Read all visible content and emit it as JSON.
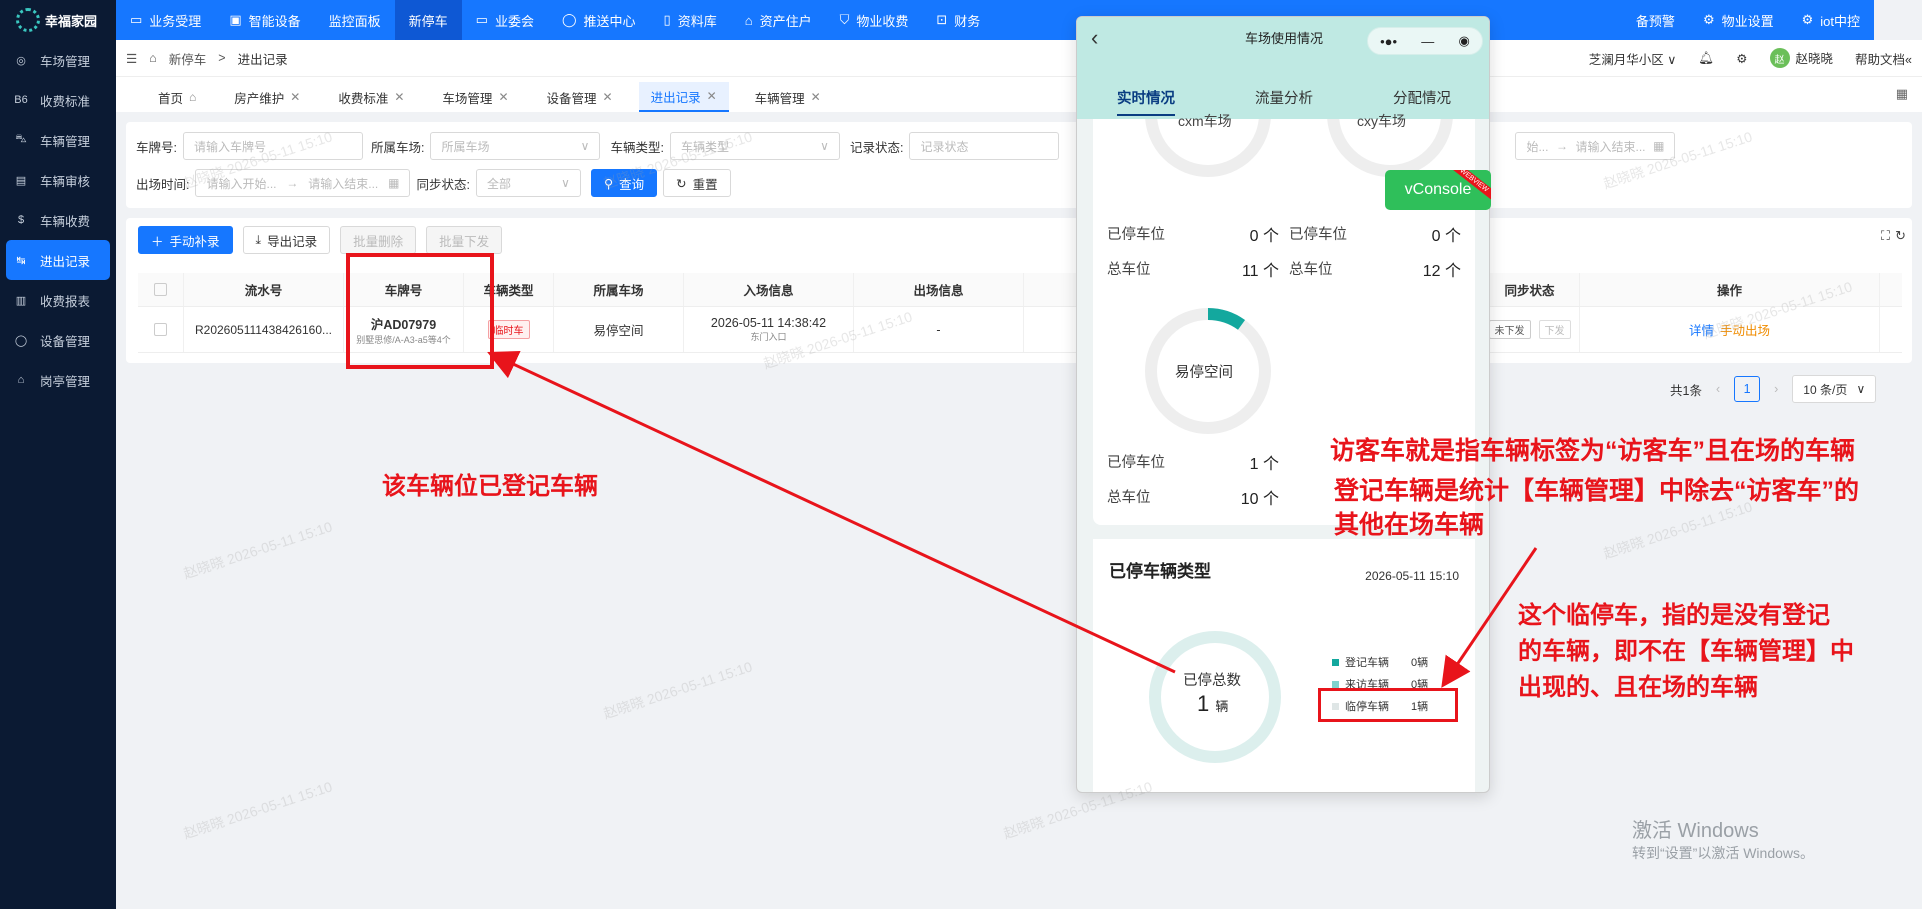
{
  "app": {
    "name": "幸福家园"
  },
  "sidebar": {
    "items": [
      {
        "label": "车场管理",
        "icon": "gauge-icon",
        "glyph": "◎"
      },
      {
        "label": "收费标准",
        "icon": "bo-icon",
        "glyph": "B6"
      },
      {
        "label": "车辆管理",
        "icon": "car-icon",
        "glyph": "⛍"
      },
      {
        "label": "车辆审核",
        "icon": "audit-icon",
        "glyph": "▤"
      },
      {
        "label": "车辆收费",
        "icon": "coin-icon",
        "glyph": "$"
      },
      {
        "label": "进出记录",
        "icon": "record-icon",
        "glyph": "↹"
      },
      {
        "label": "收费报表",
        "icon": "report-icon",
        "glyph": "▥"
      },
      {
        "label": "设备管理",
        "icon": "device-icon",
        "glyph": "◯"
      },
      {
        "label": "岗亭管理",
        "icon": "booth-icon",
        "glyph": "⌂"
      }
    ],
    "active": 5
  },
  "topnav": {
    "items": [
      {
        "label": "业务受理",
        "glyph": "▭"
      },
      {
        "label": "智能设备",
        "glyph": "▣"
      },
      {
        "label": "监控面板",
        "glyph": ""
      },
      {
        "label": "新停车",
        "glyph": ""
      },
      {
        "label": "业委会",
        "glyph": "▭"
      },
      {
        "label": "推送中心",
        "glyph": "◯"
      },
      {
        "label": "资料库",
        "glyph": "▯"
      },
      {
        "label": "资产住户",
        "glyph": "⌂"
      },
      {
        "label": "物业收费",
        "glyph": "⛉"
      },
      {
        "label": "财务",
        "glyph": "⊡"
      }
    ],
    "right_items": [
      {
        "label": "备预警",
        "glyph": ""
      },
      {
        "label": "物业设置",
        "glyph": "⚙"
      },
      {
        "label": "iot中控",
        "glyph": "⚙"
      }
    ]
  },
  "breadcrumb": {
    "parent": "新停车",
    "separator": ">",
    "current": "进出记录"
  },
  "header_right": {
    "community": "芝澜月华小区",
    "user_initial": "赵",
    "user": "赵晓晓",
    "help": "帮助文档"
  },
  "tabs": [
    {
      "label": "首页",
      "closable": false
    },
    {
      "label": "房产维护",
      "closable": true
    },
    {
      "label": "收费标准",
      "closable": true
    },
    {
      "label": "车场管理",
      "closable": true
    },
    {
      "label": "设备管理",
      "closable": true
    },
    {
      "label": "进出记录",
      "closable": true,
      "active": true
    },
    {
      "label": "车辆管理",
      "closable": true
    }
  ],
  "filters": {
    "plate_label": "车牌号:",
    "plate_placeholder": "请输入车牌号",
    "lot_label": "所属车场:",
    "lot_placeholder": "所属车场",
    "type_label": "车辆类型:",
    "type_placeholder": "车辆类型",
    "status_label": "记录状态:",
    "status_placeholder": "记录状态",
    "range_start": "始...",
    "range_end": "请输入结束...",
    "time_label": "出场时间:",
    "time_start": "请输入开始...",
    "time_end": "请输入结束...",
    "sync_label": "同步状态:",
    "sync_value": "全部",
    "search": "查询",
    "reset": "重置"
  },
  "actions": {
    "manual_add": "手动补录",
    "export": "导出记录",
    "batch_delete": "批量删除",
    "batch_issue": "批量下发"
  },
  "table": {
    "headers": {
      "serial": "流水号",
      "plate": "车牌号",
      "type": "车辆类型",
      "lot": "所属车场",
      "entry": "入场信息",
      "exit": "出场信息",
      "sync": "同步状态",
      "ops": "操作"
    },
    "rows": [
      {
        "serial": "R202605111438426160...",
        "plate": "沪AD07979",
        "plate_sub": "别墅思修/A-A3-a5等4个",
        "type": "临时车",
        "lot": "易停空间",
        "entry_time": "2026-05-11 14:38:42",
        "entry_gate": "东门入口",
        "exit": "-",
        "sync": "未下发",
        "sync_btn": "下发",
        "op_detail": "详情",
        "op_exit": "手动出场"
      }
    ]
  },
  "pagination": {
    "total": "共1条",
    "prev": "‹",
    "page": "1",
    "next": "›",
    "page_size": "10 条/页"
  },
  "phone": {
    "title": "车场使用情况",
    "tabs": [
      "实时情况",
      "流量分析",
      "分配情况"
    ],
    "lots_top": [
      {
        "name": "cxm车场"
      },
      {
        "name": "cxy车场"
      }
    ],
    "stats_top": [
      {
        "parked_label": "已停车位",
        "parked": "0 个",
        "total_label": "总车位",
        "total": "11 个"
      },
      {
        "parked_label": "已停车位",
        "parked": "0 个",
        "total_label": "总车位",
        "total": "12 个"
      }
    ],
    "lot3": {
      "name": "易停空间",
      "parked_label": "已停车位",
      "parked": "1 个",
      "total_label": "总车位",
      "total": "10 个",
      "occupancy": 0.1
    },
    "type_card": {
      "title": "已停车辆类型",
      "time": "2026-05-11 15:10",
      "center_label": "已停总数",
      "center_value": "1",
      "center_unit": "辆",
      "legend": [
        {
          "label": "登记车辆",
          "value": "0辆",
          "color": "#13a89e"
        },
        {
          "label": "来访车辆",
          "value": "0辆",
          "color": "#7fd3cd"
        },
        {
          "label": "临停车辆",
          "value": "1辆",
          "color": "#dfe6e6"
        }
      ]
    }
  },
  "vconsole": {
    "label": "vConsole",
    "badge": "WEBVIEW"
  },
  "annotations": {
    "a1": "该车辆位已登记车辆",
    "a2": "访客车就是指车辆标签为“访客车”且在场的车辆",
    "a3_line1": "登记车辆是统计【车辆管理】中除去“访客车”的",
    "a3_line2": "其他在场车辆",
    "a4_line1": "这个临停车，指的是没有登记",
    "a4_line2": "的车辆，即不在【车辆管理】中",
    "a4_line3": "出现的、且在场的车辆"
  },
  "windows": {
    "line1": "激活 Windows",
    "line2": "转到“设置”以激活 Windows。"
  },
  "watermark": "赵晓晓 2026-05-11 15:10",
  "colors": {
    "primary": "#1677ff",
    "annotation": "#e8141b",
    "teal": "#13a89e"
  }
}
